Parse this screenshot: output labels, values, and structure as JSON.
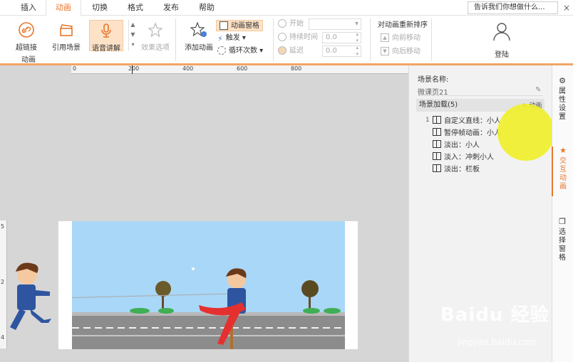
{
  "tabs": [
    {
      "label": "插入",
      "active": false
    },
    {
      "label": "动画",
      "active": true
    },
    {
      "label": "切换",
      "active": false
    },
    {
      "label": "格式",
      "active": false
    },
    {
      "label": "发布",
      "active": false
    },
    {
      "label": "帮助",
      "active": false
    }
  ],
  "search": {
    "placeholder": "告诉我们你想做什么..."
  },
  "ribbon": {
    "hyperlink": "超链接",
    "ref_scene": "引用场景",
    "voice": "语音讲解",
    "effects": "效果选项",
    "add_anim": "添加动画",
    "anim_pane": "动画窗格",
    "trigger": "触发",
    "loop": "循环次数",
    "start": "开始",
    "duration": "持续时间",
    "delay": "延迟",
    "duration_value": "0.0",
    "delay_value": "0.0",
    "reorder": "对动画重新排序",
    "move_up": "向前移动",
    "move_down": "向后移动",
    "login": "登陆",
    "group_anim": "动画"
  },
  "ruler": {
    "marks": [
      "0",
      "200",
      "400",
      "600",
      "800"
    ],
    "vmarks": [
      "5",
      "2",
      "4"
    ]
  },
  "panel": {
    "scene_label": "场景名称:",
    "scene_name": "微课页21",
    "load_header": "场景加载(5)",
    "add_anim": "+ 动画",
    "first_index": "1",
    "items": [
      "自定义直线：小人",
      "暂停帧动画：小人",
      "淡出：小人",
      "淡入：冲刺小人",
      "淡出：栏板"
    ]
  },
  "sidetabs": {
    "props": "属性设置",
    "interact": "交互动画",
    "select": "选择窗格"
  },
  "watermark": {
    "main": "Baidu 经验",
    "sub": "jingyan.baidu.com"
  }
}
